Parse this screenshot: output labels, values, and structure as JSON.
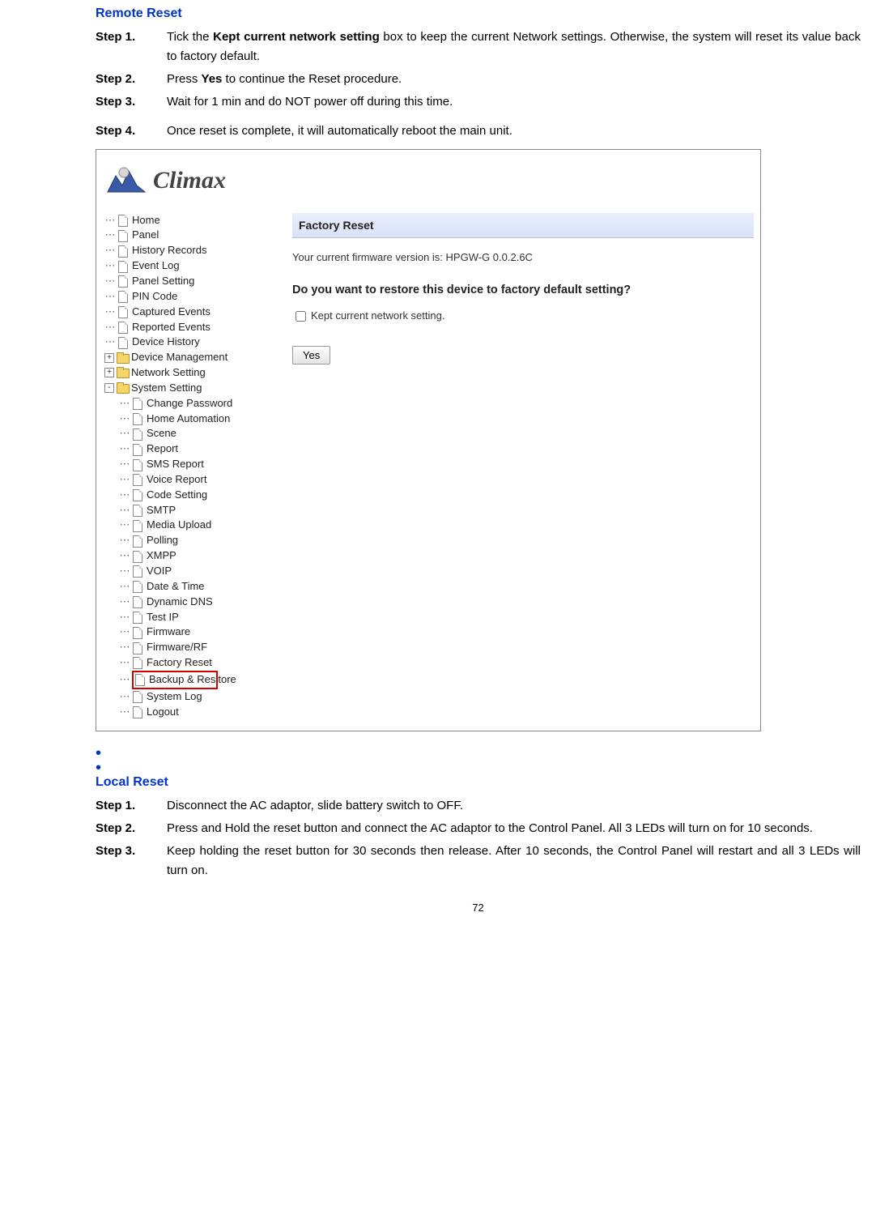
{
  "remote_reset": {
    "title": "Remote Reset",
    "steps": [
      {
        "label": "Step 1.",
        "pre": "Tick the ",
        "bold": "Kept current network setting",
        "post": " box to keep the current Network settings. Otherwise, the system will reset its value back to factory default."
      },
      {
        "label": "Step 2.",
        "pre": "Press ",
        "bold": "Yes",
        "post": " to continue the Reset procedure."
      },
      {
        "label": "Step 3.",
        "pre": "Wait for 1 min and do NOT power off during this time.",
        "bold": "",
        "post": ""
      },
      {
        "label": "Step 4.",
        "pre": "Once reset is complete, it will automatically reboot the main unit.",
        "bold": "",
        "post": ""
      }
    ]
  },
  "screenshot": {
    "logo_text": "Climax",
    "tree": {
      "items_top": [
        "Home",
        "Panel",
        "History Records",
        "Event Log",
        "Panel Setting",
        "PIN Code",
        "Captured Events",
        "Reported Events",
        "Device History"
      ],
      "folders": [
        {
          "expander": "+",
          "label": "Device Management"
        },
        {
          "expander": "+",
          "label": "Network Setting"
        },
        {
          "expander": "-",
          "label": "System Setting"
        }
      ],
      "sub_items": [
        "Change Password",
        "Home Automation",
        "Scene",
        "Report",
        "SMS Report",
        "Voice Report",
        "Code Setting",
        "SMTP",
        "Media Upload",
        "Polling",
        "XMPP",
        "VOIP",
        "Date & Time",
        "Dynamic DNS",
        "Test IP",
        "Firmware",
        "Firmware/RF",
        "Factory Reset"
      ],
      "highlighted": "Backup & Res",
      "highlight_suffix": "tore",
      "after_highlight": [
        "System Log",
        "Logout"
      ]
    },
    "panel": {
      "header": "Factory Reset",
      "fw_text_pre": "Your current firmware version is: ",
      "fw_version": "HPGW-G 0.0.2.6C",
      "question": "Do you want to restore this device to factory default setting?",
      "checkbox_label": "Kept current network setting.",
      "button_label": "Yes"
    }
  },
  "local_reset": {
    "title": "Local Reset",
    "steps": [
      {
        "label": "Step 1.",
        "text": "Disconnect the AC adaptor, slide battery switch to OFF."
      },
      {
        "label": "Step 2.",
        "text": "Press and Hold the reset button and connect the AC adaptor to the Control Panel. All 3 LEDs will turn on for 10 seconds."
      },
      {
        "label": "Step 3.",
        "text": "Keep holding the reset button for 30 seconds then release. After 10 seconds, the Control Panel will restart and all 3 LEDs will turn on."
      }
    ]
  },
  "page_number": "72"
}
